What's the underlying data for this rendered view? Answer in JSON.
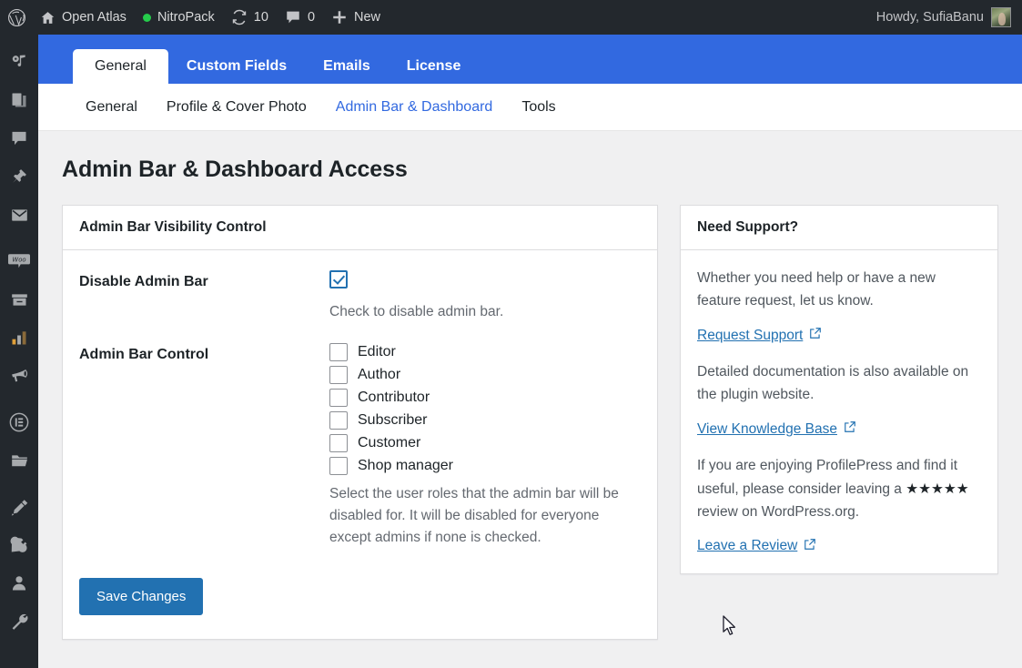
{
  "adminbar": {
    "logo_icon": "wordpress-logo-icon",
    "items": [
      {
        "icon": "home-icon",
        "label": "Open Atlas"
      },
      {
        "icon": "green-dot-icon",
        "label": "NitroPack"
      },
      {
        "icon": "updates-icon",
        "label": "10"
      },
      {
        "icon": "comment-icon",
        "label": "0"
      },
      {
        "icon": "plus-icon",
        "label": "New"
      }
    ],
    "account": {
      "greeting": "Howdy, SufiaBanu",
      "avatar": "user-avatar"
    }
  },
  "adminmenu": {
    "items": [
      {
        "icon": "media-music-icon",
        "name": "media"
      },
      {
        "icon": "pages-icon",
        "name": "pages"
      },
      {
        "icon": "comments-icon",
        "name": "comments"
      },
      {
        "icon": "pin-icon",
        "name": "pin"
      },
      {
        "icon": "mail-icon",
        "name": "mail"
      },
      {
        "icon": "woocommerce-icon",
        "name": "woocommerce"
      },
      {
        "icon": "products-box-icon",
        "name": "products"
      },
      {
        "icon": "analytics-bars-icon",
        "name": "analytics"
      },
      {
        "icon": "marketing-megaphone-icon",
        "name": "marketing"
      },
      {
        "icon": "elementor-icon",
        "name": "elementor"
      },
      {
        "icon": "folder-icon",
        "name": "templates"
      },
      {
        "icon": "appearance-brush-icon",
        "name": "appearance"
      },
      {
        "icon": "plugins-plug-icon",
        "name": "plugins"
      },
      {
        "icon": "users-icon",
        "name": "users"
      },
      {
        "icon": "tools-wrench-icon",
        "name": "tools"
      }
    ]
  },
  "primary_tabs": [
    {
      "label": "General",
      "active": true
    },
    {
      "label": "Custom Fields",
      "active": false
    },
    {
      "label": "Emails",
      "active": false
    },
    {
      "label": "License",
      "active": false
    }
  ],
  "sub_tabs": [
    {
      "label": "General",
      "active": false
    },
    {
      "label": "Profile & Cover Photo",
      "active": false
    },
    {
      "label": "Admin Bar & Dashboard",
      "active": true
    },
    {
      "label": "Tools",
      "active": false
    }
  ],
  "page": {
    "title": "Admin Bar & Dashboard Access"
  },
  "main_panel": {
    "header": "Admin Bar Visibility Control",
    "disable_admin_bar": {
      "label": "Disable Admin Bar",
      "checked": true,
      "help": "Check to disable admin bar."
    },
    "admin_bar_control": {
      "label": "Admin Bar Control",
      "roles": [
        {
          "label": "Editor",
          "checked": false
        },
        {
          "label": "Author",
          "checked": false
        },
        {
          "label": "Contributor",
          "checked": false
        },
        {
          "label": "Subscriber",
          "checked": false
        },
        {
          "label": "Customer",
          "checked": false
        },
        {
          "label": "Shop manager",
          "checked": false
        }
      ],
      "help": "Select the user roles that the admin bar will be disabled for. It will be disabled for everyone except admins if none is checked."
    },
    "save_label": "Save Changes"
  },
  "side_panel": {
    "header": "Need Support?",
    "p1": "Whether you need help or have a new feature request, let us know.",
    "link1": "Request Support",
    "p2": "Detailed documentation is also available on the plugin website.",
    "link2": "View Knowledge Base",
    "p3_before": "If you are enjoying ProfilePress and find it useful, please consider leaving a ",
    "stars": "★★★★★",
    "p3_after": " review on WordPress.org.",
    "link3": "Leave a Review"
  },
  "colors": {
    "adminbar_bg": "#23282d",
    "tabbar_blue": "#3269e0",
    "link_blue": "#2271b1",
    "page_bg": "#f0f0f1",
    "button_blue": "#2271b1",
    "green_dot": "#25cc4b"
  }
}
